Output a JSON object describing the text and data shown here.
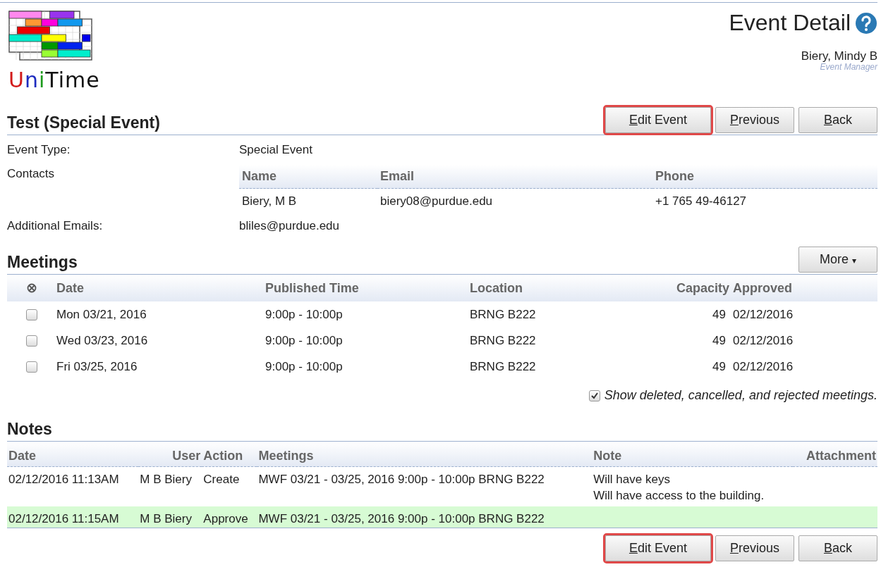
{
  "logo": {
    "text": "UniTime"
  },
  "header": {
    "title": "Event Detail",
    "user": "Biery, Mindy B",
    "role": "Event Manager"
  },
  "event": {
    "title": "Test (Special Event)",
    "buttons": [
      {
        "key": "E",
        "rest": "dit Event",
        "highlighted": true
      },
      {
        "key": "P",
        "rest": "revious",
        "highlighted": false
      },
      {
        "key": "B",
        "rest": "ack",
        "highlighted": false
      }
    ],
    "fields": [
      {
        "kind": "text",
        "label": "Event Type:",
        "value": "Special Event"
      },
      {
        "kind": "contacts",
        "label": "Contacts",
        "columns": [
          "Name",
          "Email",
          "Phone"
        ],
        "rows": [
          [
            "Biery, M B",
            "biery08@purdue.edu",
            "+1 765 49-46127"
          ]
        ]
      },
      {
        "kind": "text",
        "label": "Additional Emails:",
        "value": "bliles@purdue.edu"
      }
    ]
  },
  "meetings": {
    "title": "Meetings",
    "more_button": "More",
    "more_caret": "▾",
    "columns": [
      "Date",
      "Published Time",
      "Location",
      "Capacity",
      "Approved"
    ],
    "rows": [
      {
        "checked": false,
        "cells": [
          "Mon 03/21, 2016",
          "9:00p - 10:00p",
          "BRNG B222",
          "49",
          "02/12/2016"
        ]
      },
      {
        "checked": false,
        "cells": [
          "Wed 03/23, 2016",
          "9:00p - 10:00p",
          "BRNG B222",
          "49",
          "02/12/2016"
        ]
      },
      {
        "checked": false,
        "cells": [
          "Fri 03/25, 2016",
          "9:00p - 10:00p",
          "BRNG B222",
          "49",
          "02/12/2016"
        ]
      }
    ],
    "show_deleted": {
      "checked": true,
      "label": "Show deleted, cancelled, and rejected meetings."
    }
  },
  "notes": {
    "title": "Notes",
    "columns": [
      "Date",
      "User",
      "Action",
      "Meetings",
      "Note",
      "Attachment"
    ],
    "rows": [
      {
        "color": "#ffffff",
        "cells": [
          "02/12/2016 11:13AM",
          "M B Biery",
          "Create",
          "MWF 03/21 - 03/25, 2016 9:00p - 10:00p BRNG B222"
        ],
        "note": [
          "Will have keys",
          "Will have access to the building."
        ]
      },
      {
        "color": "#d7fbd4",
        "cells": [
          "02/12/2016 11:15AM",
          "M B Biery",
          "Approve",
          "MWF 03/21 - 03/25, 2016 9:00p - 10:00p BRNG B222"
        ],
        "note": []
      }
    ]
  },
  "footer_buttons": [
    {
      "key": "E",
      "rest": "dit Event",
      "highlighted": true
    },
    {
      "key": "P",
      "rest": "revious",
      "highlighted": false
    },
    {
      "key": "B",
      "rest": "ack",
      "highlighted": false
    }
  ]
}
